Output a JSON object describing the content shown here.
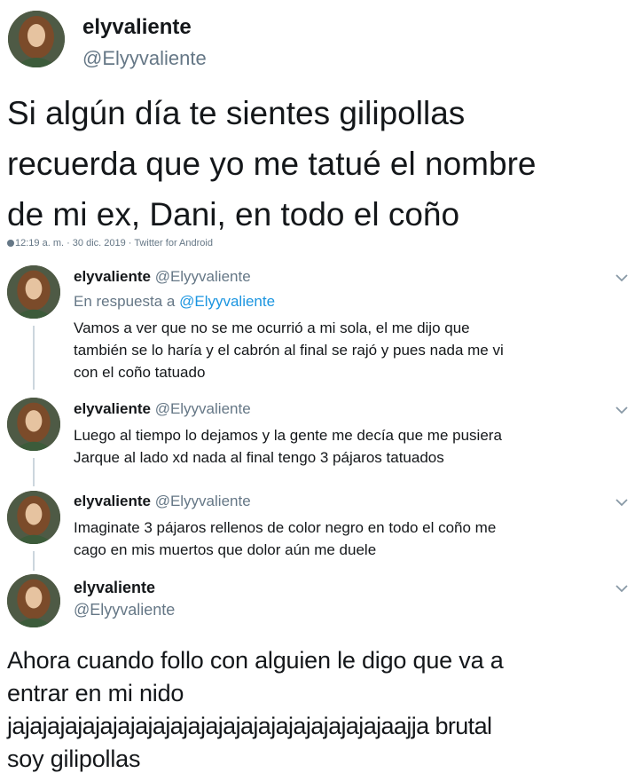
{
  "header": {
    "display_name": "elyvaliente",
    "handle": "@Elyyvaliente"
  },
  "main_tweet": {
    "text_lines": [
      "Si algún día te sientes gilipollas",
      "recuerda que yo me tatué el nombre",
      "de mi ex, Dani, en todo el coño"
    ],
    "timestamp": "12:19 a. m. · 30 dic. 2019 · Twitter for Android"
  },
  "replies": [
    {
      "display_name": "elyvaliente",
      "handle": "@Elyyvaliente",
      "reply_to_prefix": "En respuesta a",
      "reply_to_handle": "@Elyyvaliente",
      "lines": [
        "Vamos a ver que no se me ocurrió a mi sola, el me dijo que",
        "también se lo haría y el cabrón al final se rajó y pues nada me vi",
        "con el coño tatuado"
      ]
    },
    {
      "display_name": "elyvaliente",
      "handle": "@Elyyvaliente",
      "lines": [
        "Luego al tiempo lo dejamos y la gente me decía que me pusiera",
        "Jarque al lado xd nada al final tengo 3 pájaros tatuados"
      ]
    },
    {
      "display_name": "elyvaliente",
      "handle": "@Elyyvaliente",
      "lines": [
        "Imaginate 3 pájaros rellenos de color negro en todo el coño me",
        "cago en mis muertos que dolor aún me duele"
      ]
    },
    {
      "display_name": "elyvaliente",
      "handle": "@Elyyvaliente"
    }
  ],
  "final_tweet": {
    "lines": [
      "Ahora cuando follo con alguien le digo que va a",
      "entrar en mi nido",
      "jajajajajajajajajajajajajajajajajajajajajajaajja brutal",
      "soy gilipollas"
    ]
  },
  "icons": {
    "chevron": "chevron-down-icon",
    "timestamp": "clock-globe-icon"
  }
}
